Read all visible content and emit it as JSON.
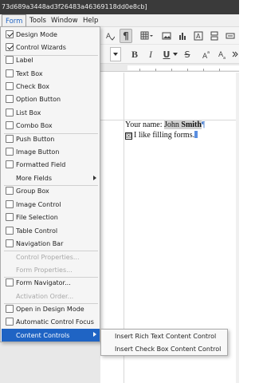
{
  "window": {
    "title": "73d689a3448ad3f26483a46369118dd0e8cb]"
  },
  "menubar": {
    "items": [
      "Form",
      "Tools",
      "Window",
      "Help"
    ],
    "active": "Form"
  },
  "form_menu": {
    "items": [
      {
        "label": "Design Mode",
        "checked": true,
        "enabled": true
      },
      {
        "label": "Control Wizards",
        "checked": true,
        "enabled": true
      },
      {
        "label": "Label",
        "checked": false,
        "enabled": true
      },
      {
        "label": "Text Box",
        "checked": false,
        "enabled": true
      },
      {
        "label": "Check Box",
        "checked": false,
        "enabled": true
      },
      {
        "label": "Option Button",
        "checked": false,
        "enabled": true
      },
      {
        "label": "List Box",
        "checked": false,
        "enabled": true
      },
      {
        "label": "Combo Box",
        "checked": false,
        "enabled": true
      },
      {
        "label": "Push Button",
        "checked": false,
        "enabled": true
      },
      {
        "label": "Image Button",
        "checked": false,
        "enabled": true
      },
      {
        "label": "Formatted Field",
        "checked": false,
        "enabled": true
      },
      {
        "label": "More Fields",
        "submenu": true,
        "enabled": true
      },
      {
        "label": "Group Box",
        "checked": false,
        "enabled": true
      },
      {
        "label": "Image Control",
        "checked": false,
        "enabled": true
      },
      {
        "label": "File Selection",
        "checked": false,
        "enabled": true
      },
      {
        "label": "Table Control",
        "checked": false,
        "enabled": true
      },
      {
        "label": "Navigation Bar",
        "checked": false,
        "enabled": true
      },
      {
        "label": "Control Properties...",
        "enabled": false
      },
      {
        "label": "Form Properties...",
        "enabled": false
      },
      {
        "label": "Form Navigator...",
        "checked": false,
        "enabled": true
      },
      {
        "label": "Activation Order...",
        "enabled": false
      },
      {
        "label": "Open in Design Mode",
        "checked": false,
        "enabled": true
      },
      {
        "label": "Automatic Control Focus",
        "checked": false,
        "enabled": true
      },
      {
        "label": "Content Controls",
        "submenu": true,
        "enabled": true,
        "highlighted": true
      }
    ]
  },
  "content_controls_submenu": {
    "items": [
      "Insert Rich Text Content Control",
      "Insert Check Box Content Control"
    ]
  },
  "toolbar": {
    "pilcrow": "¶",
    "bold": "B",
    "italic": "I",
    "underline": "U",
    "strike": "S"
  },
  "document": {
    "line1_label": "Your name: ",
    "line1_first": "John ",
    "line1_last": "Smith",
    "line2_checkbox": "☒",
    "line2_text": "I like filling forms.",
    "pilcrow": "¶"
  },
  "colors": {
    "accent": "#1f64c4",
    "pilcrow": "#4a7fd0",
    "field_shading": "#d0d0d0"
  }
}
